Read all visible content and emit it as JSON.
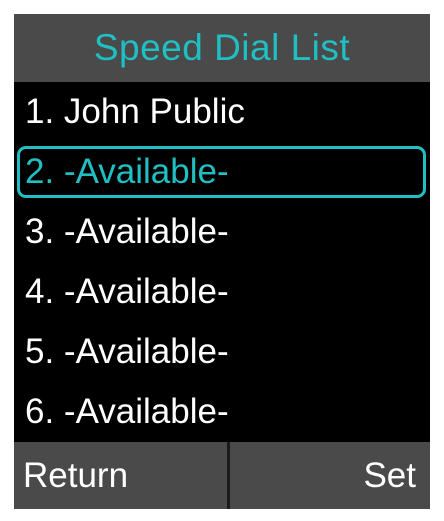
{
  "header": {
    "title": "Speed Dial List"
  },
  "speed_dial": {
    "selected_index": 1,
    "items": [
      {
        "label": "1. John Public"
      },
      {
        "label": "2. -Available-"
      },
      {
        "label": "3. -Available-"
      },
      {
        "label": "4. -Available-"
      },
      {
        "label": "5. -Available-"
      },
      {
        "label": "6. -Available-"
      }
    ]
  },
  "softkeys": {
    "left_label": "Return",
    "right_label": "Set"
  },
  "colors": {
    "accent": "#1fbfc3",
    "bar_background": "#4a4a4a",
    "screen_background": "#000000",
    "text": "#ffffff"
  }
}
